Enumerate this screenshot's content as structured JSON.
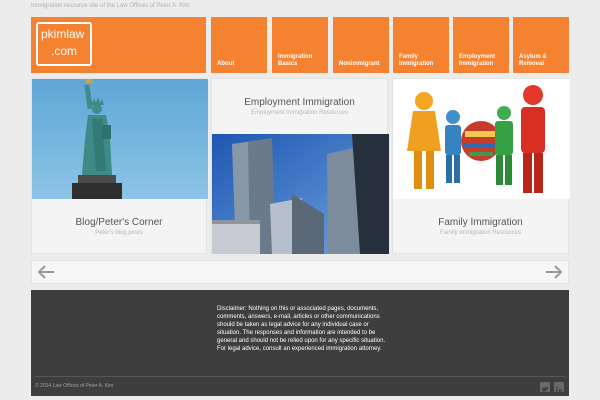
{
  "header": {
    "tagline": "Immigration resource site of the Law Offices of Peter A. Kim",
    "logo_line1": "pkimlaw",
    "logo_line2": ".com"
  },
  "nav": [
    {
      "line1": "About",
      "line2": ""
    },
    {
      "line1": "Immigration",
      "line2": "Basics"
    },
    {
      "line1": "Nonimmigrant",
      "line2": ""
    },
    {
      "line1": "Family",
      "line2": "Immigration"
    },
    {
      "line1": "Employment",
      "line2": "Immigration"
    },
    {
      "line1": "Asylum &",
      "line2": "Removal"
    }
  ],
  "panels": {
    "blog": {
      "title": "Blog/Peter's Corner",
      "subtitle": "Peter's blog posts"
    },
    "employment": {
      "title": "Employment Immigration",
      "subtitle": "Employment Immigration Resources"
    },
    "family": {
      "title": "Family Immigration",
      "subtitle": "Family Immigration Resources"
    }
  },
  "footer": {
    "disclaimer": "Disclaimer: Nothing on this or associated pages, documents, comments, answers, e-mail, articles or other communications should be taken as legal advice for any individual case or situation. The responses and information are intended to be general and should not be relied upon for any specific situation. For legal advice, consult an experienced immigration attorney.",
    "copyright": "© 2014 Law Offices of Peter A. Kim"
  },
  "icons": {
    "prev": "left-arrow-icon",
    "next": "right-arrow-icon",
    "social1": "twitter-icon",
    "social2": "linkedin-icon"
  },
  "colors": {
    "accent": "#f58231",
    "footer_bg": "#3e3e3e",
    "page_bg": "#ececec"
  }
}
